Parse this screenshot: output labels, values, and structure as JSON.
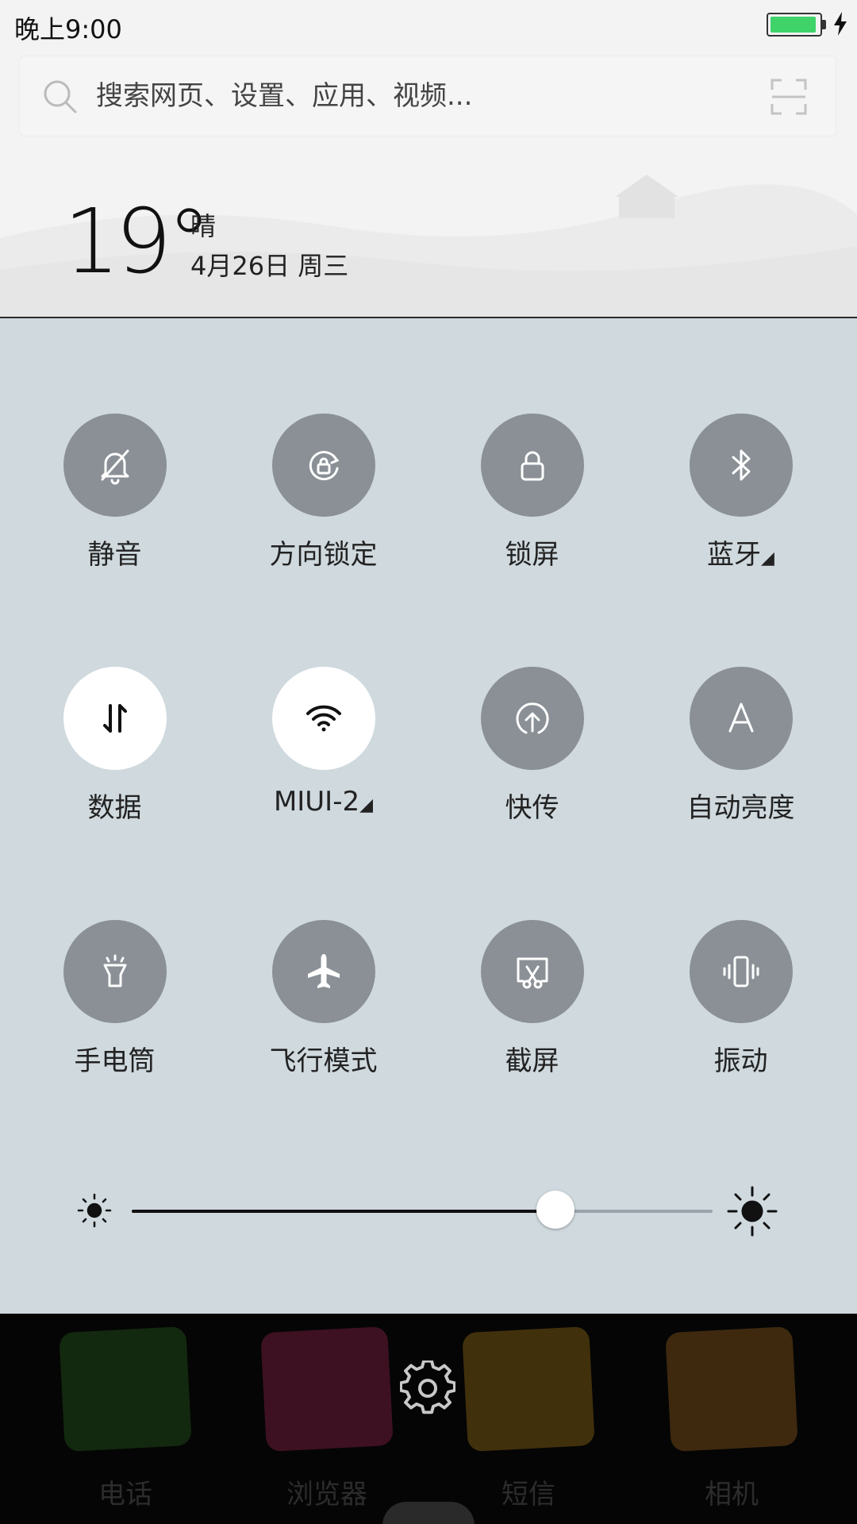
{
  "status_bar": {
    "time": "晚上9:00",
    "battery_level": 0.95,
    "battery_color": "#3fd36a"
  },
  "search": {
    "placeholder": "搜索网页、设置、应用、视频..."
  },
  "weather": {
    "temperature": "19°",
    "condition": "晴",
    "date": "4月26日 周三"
  },
  "toggles": [
    {
      "label": "静音",
      "icon": "bell-off-icon",
      "active": false
    },
    {
      "label": "方向锁定",
      "icon": "rotation-lock-icon",
      "active": false
    },
    {
      "label": "锁屏",
      "icon": "lock-icon",
      "active": false
    },
    {
      "label": "蓝牙",
      "icon": "bluetooth-icon",
      "active": false,
      "has_submenu": true
    },
    {
      "label": "数据",
      "icon": "data-arrows-icon",
      "active": true
    },
    {
      "label": "MIUI-2",
      "icon": "wifi-icon",
      "active": true,
      "has_submenu": true
    },
    {
      "label": "快传",
      "icon": "upload-icon",
      "active": false
    },
    {
      "label": "自动亮度",
      "icon": "auto-brightness-icon",
      "active": false
    },
    {
      "label": "手电筒",
      "icon": "flashlight-icon",
      "active": false
    },
    {
      "label": "飞行模式",
      "icon": "airplane-icon",
      "active": false
    },
    {
      "label": "截屏",
      "icon": "screenshot-icon",
      "active": false
    },
    {
      "label": "振动",
      "icon": "vibrate-icon",
      "active": false
    }
  ],
  "brightness": {
    "level": 0.73
  },
  "dock": {
    "apps": [
      {
        "label": "电话",
        "icon": "whatsapp-phone-icon",
        "color": "#3a8a2a"
      },
      {
        "label": "浏览器",
        "icon": "dribbble-browser-icon",
        "color": "#d0336a"
      },
      {
        "label": "短信",
        "icon": "mail-icon",
        "color": "#e0a020"
      },
      {
        "label": "相机",
        "icon": "instagram-camera-icon",
        "color": "#d58a2a"
      }
    ]
  },
  "colors": {
    "toggle_off": "#8a9096",
    "toggle_on": "#ffffff",
    "panel_bg": "#cfd9de"
  }
}
